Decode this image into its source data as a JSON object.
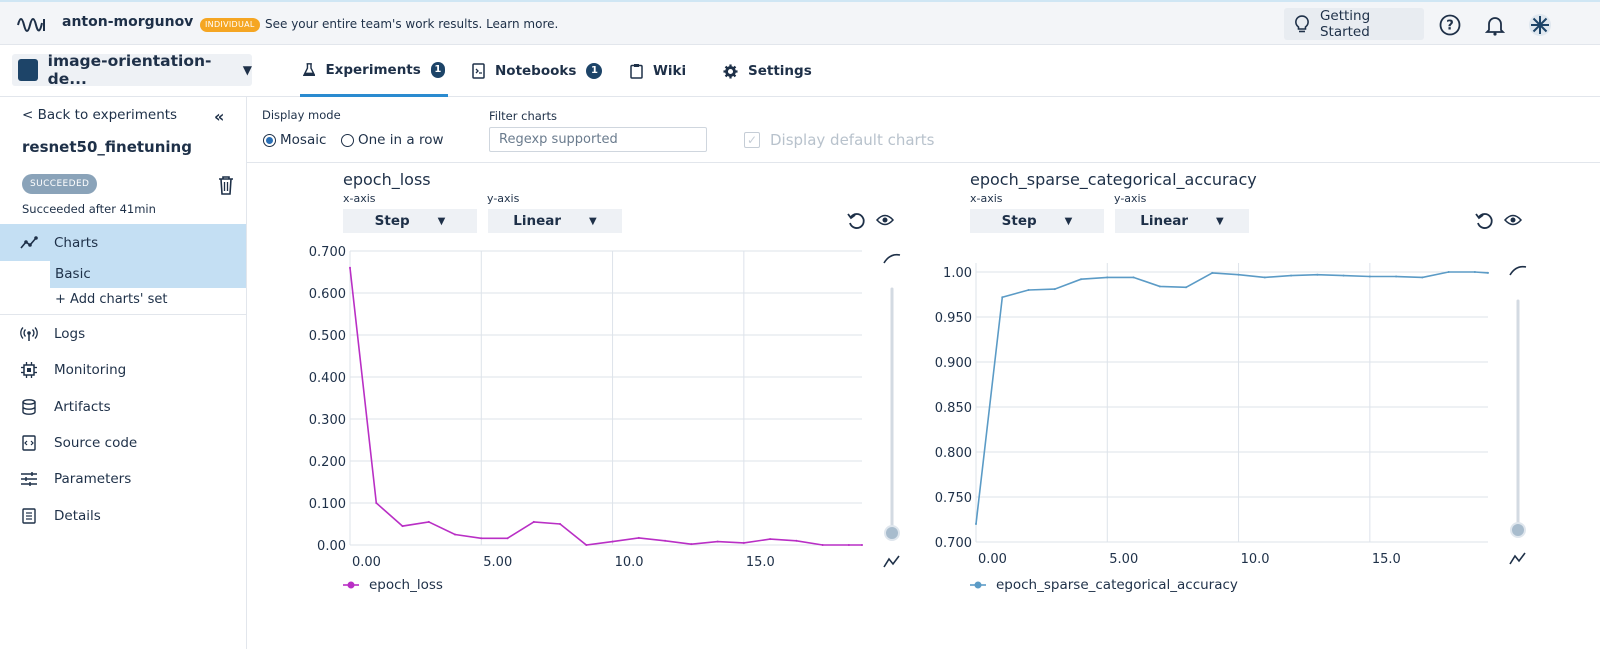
{
  "topbar": {
    "owner": "anton-morgunov",
    "badge": "INDIVIDUAL",
    "promo": "See your entire team's work results. Learn more.",
    "getting_started": "Getting Started"
  },
  "project": {
    "name": "image-orientation-de...",
    "tabs": [
      {
        "label": "Experiments",
        "count": "1",
        "active": true
      },
      {
        "label": "Notebooks",
        "count": "1"
      },
      {
        "label": "Wiki"
      },
      {
        "label": "Settings"
      }
    ]
  },
  "sidebar": {
    "back": "< Back to experiments",
    "experiment": "resnet50_finetuning",
    "status": "SUCCEEDED",
    "status_text": "Succeeded after 41min",
    "charts": "Charts",
    "basic": "Basic",
    "add_set": "+ Add charts' set",
    "items": [
      "Logs",
      "Monitoring",
      "Artifacts",
      "Source code",
      "Parameters",
      "Details"
    ]
  },
  "controls": {
    "display_mode_label": "Display mode",
    "mosaic": "Mosaic",
    "one_in_row": "One in a row",
    "filter_label": "Filter charts",
    "filter_placeholder": "Regexp supported",
    "display_default": "Display default charts"
  },
  "colors": {
    "loss": "#b92fc5",
    "accuracy": "#5b9bc6",
    "accent": "#2a8bd0",
    "selected": "#c4dff3"
  },
  "charts": [
    {
      "title": "epoch_loss",
      "xaxis_label": "x-axis",
      "yaxis_label": "y-axis",
      "xaxis_value": "Step",
      "yaxis_value": "Linear",
      "legend": "epoch_loss"
    },
    {
      "title": "epoch_sparse_categorical_accuracy",
      "xaxis_label": "x-axis",
      "yaxis_label": "y-axis",
      "xaxis_value": "Step",
      "yaxis_value": "Linear",
      "legend": "epoch_sparse_categorical_accuracy"
    }
  ],
  "chart_data": [
    {
      "type": "line",
      "title": "epoch_loss",
      "xlim": [
        0,
        19.5
      ],
      "ylim": [
        0,
        0.7
      ],
      "x_ticks": [
        "0.00",
        "5.00",
        "10.0",
        "15.0"
      ],
      "y_ticks": [
        "0.00",
        "0.100",
        "0.200",
        "0.300",
        "0.400",
        "0.500",
        "0.600",
        "0.700"
      ],
      "grid": true,
      "legend": "bottom",
      "series": [
        {
          "name": "epoch_loss",
          "x": [
            0,
            1,
            2,
            3,
            4,
            5,
            6,
            7,
            8,
            9,
            10,
            11,
            12,
            13,
            14,
            15,
            16,
            17,
            18,
            19,
            19.5
          ],
          "y": [
            0.66,
            0.1,
            0.045,
            0.055,
            0.025,
            0.016,
            0.016,
            0.055,
            0.05,
            0.0,
            0.008,
            0.017,
            0.01,
            0.002,
            0.008,
            0.005,
            0.014,
            0.01,
            0.0,
            0.0,
            0.0
          ]
        }
      ]
    },
    {
      "type": "line",
      "title": "epoch_sparse_categorical_accuracy",
      "xlim": [
        0,
        19.5
      ],
      "ylim": [
        0.7,
        1.01
      ],
      "x_ticks": [
        "0.00",
        "5.00",
        "10.0",
        "15.0"
      ],
      "y_ticks": [
        "0.700",
        "0.750",
        "0.800",
        "0.850",
        "0.900",
        "0.950",
        "1.00"
      ],
      "grid": true,
      "legend": "bottom",
      "series": [
        {
          "name": "epoch_sparse_categorical_accuracy",
          "x": [
            0,
            1,
            2,
            3,
            4,
            5,
            6,
            7,
            8,
            9,
            10,
            11,
            12,
            13,
            14,
            15,
            16,
            17,
            18,
            19,
            19.5
          ],
          "y": [
            0.72,
            0.972,
            0.98,
            0.981,
            0.992,
            0.994,
            0.994,
            0.984,
            0.983,
            0.999,
            0.997,
            0.994,
            0.996,
            0.997,
            0.996,
            0.995,
            0.995,
            0.994,
            1.0,
            1.0,
            0.999
          ]
        }
      ]
    }
  ]
}
